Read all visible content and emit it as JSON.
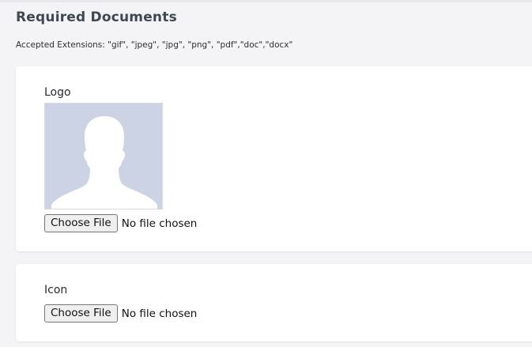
{
  "section": {
    "title": "Required Documents",
    "accepted_extensions": "Accepted Extensions: \"gif\", \"jpeg\", \"jpg\", \"png\", \"pdf\",\"doc\",\"docx\""
  },
  "fields": {
    "logo": {
      "label": "Logo",
      "button_label": "Choose File",
      "status": "No file chosen",
      "placeholder_icon": "user-silhouette-icon"
    },
    "icon": {
      "label": "Icon",
      "button_label": "Choose File",
      "status": "No file chosen"
    }
  },
  "colors": {
    "placeholder_bg": "#ccd3e4",
    "card_bg": "#ffffff",
    "page_bg": "#f4f4f6"
  }
}
